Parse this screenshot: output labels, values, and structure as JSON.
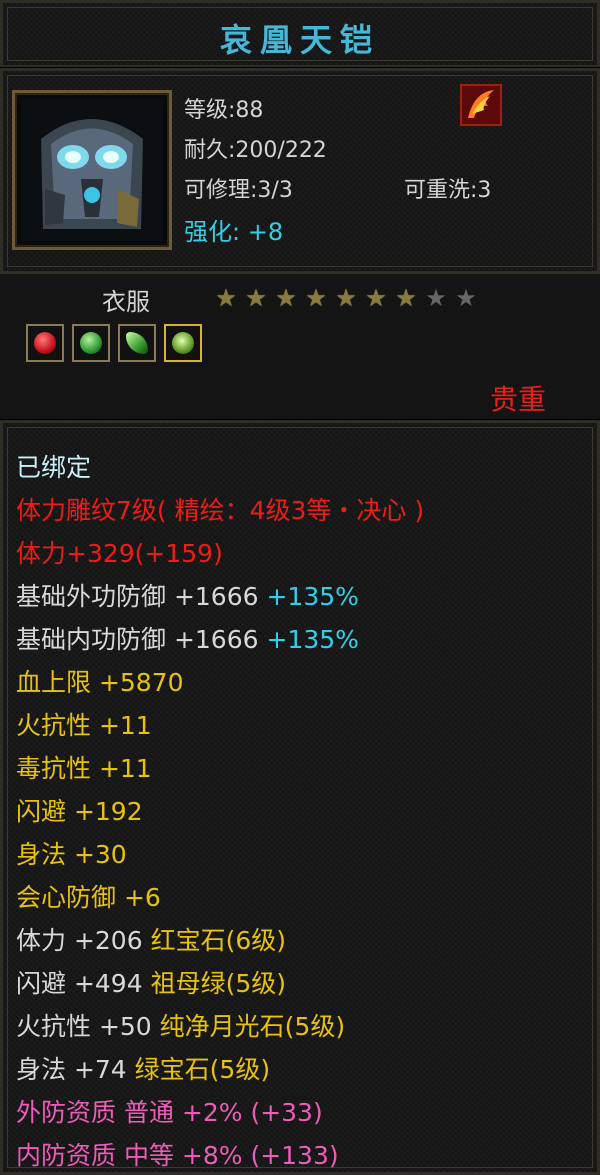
{
  "title": "哀凰天铠",
  "header": {
    "level": "等级:88",
    "durability": "耐久:200/222",
    "repair": "可修理:3/3",
    "rewash": "可重洗:3",
    "enhance": "强化: +8"
  },
  "type": {
    "label": "衣服",
    "stars_filled": 7,
    "stars_total": 9,
    "rarity": "贵重"
  },
  "gems": [
    "red-gem-icon",
    "green-gem-icon",
    "green-leaf-gem-icon",
    "green-jade-gem-icon"
  ],
  "attrs": {
    "bound": "已绑定",
    "carve": "体力雕纹7级( 精绘：4级3等・决心 )",
    "vit_main": "体力+329(+159)",
    "ext_def_a": "基础外功防御 +1666",
    "ext_def_b": "+135%",
    "int_def_a": "基础内功防御 +1666",
    "int_def_b": "+135%",
    "hp": "血上限 +5870",
    "fire": "火抗性 +11",
    "poison": "毒抗性 +11",
    "dodge": "闪避 +192",
    "agility": "身法 +30",
    "crit_def": "会心防御 +6",
    "gem1": "体力 +206 红宝石(6级)",
    "gem2": "闪避 +494 祖母绿(5级)",
    "gem3": "火抗性 +50 纯净月光石(5级)",
    "gem4": "身法 +74 绿宝石(5级)",
    "q_ext": "外防资质  普通 +2% (+33)",
    "q_int": "内防资质  中等 +8% (+133)"
  },
  "colors": {
    "title": "#49b6d6",
    "enhance": "#32d0e8",
    "rarity": "#e8201c",
    "red": "#ee1c16",
    "yellow": "#e8c20e",
    "cyan": "#32d0e8",
    "pink": "#ec5cb8"
  }
}
